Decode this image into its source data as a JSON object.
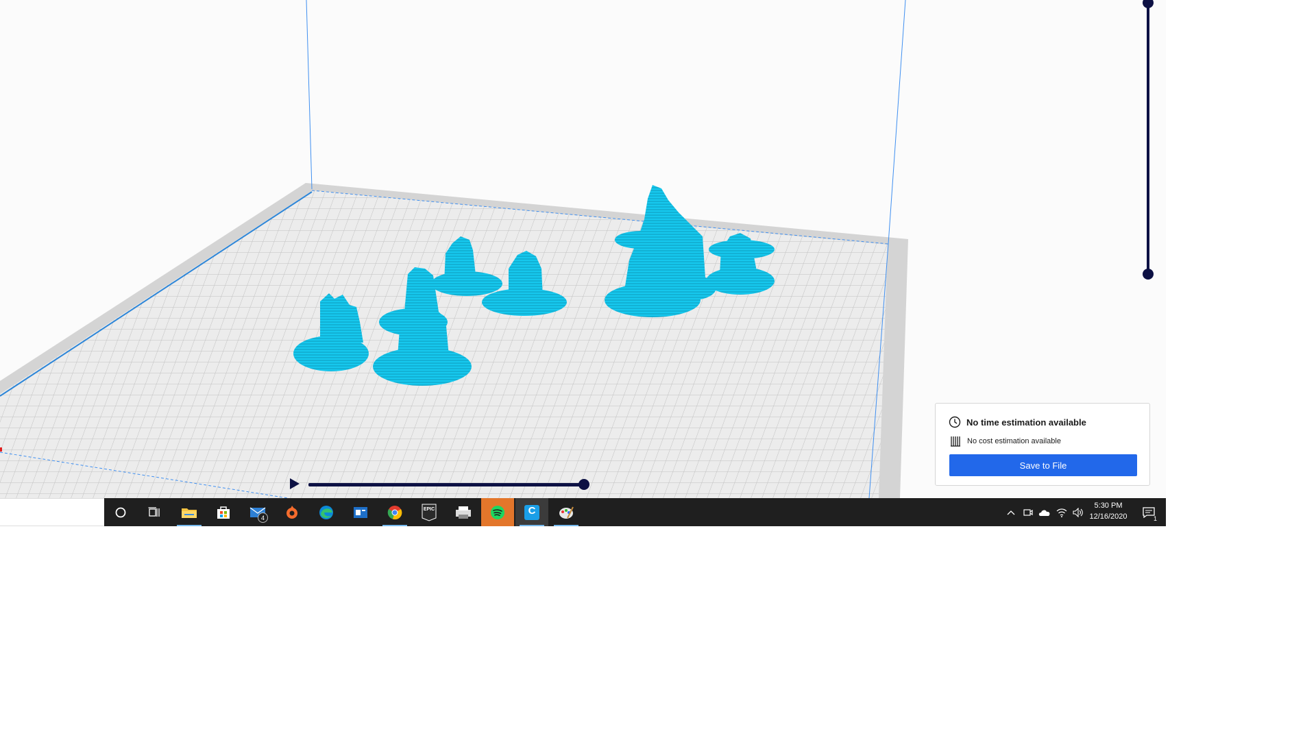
{
  "print_panel": {
    "time_estimate": "No time estimation available",
    "cost_estimate": "No cost estimation available",
    "save_label": "Save to File",
    "accent_color": "#2268ea"
  },
  "viewport": {
    "model_color": "#16c8ee",
    "buildplate_color": "#e6e6e6",
    "slider_color": "#0d1144"
  },
  "taskbar": {
    "apps": [
      {
        "icon": "cortana-circle-icon"
      },
      {
        "icon": "task-view-icon"
      },
      {
        "icon": "file-explorer-icon"
      },
      {
        "icon": "microsoft-store-icon"
      },
      {
        "icon": "mail-icon",
        "badge": "4"
      },
      {
        "icon": "origin-icon"
      },
      {
        "icon": "edge-icon"
      },
      {
        "icon": "news-icon"
      },
      {
        "icon": "chrome-icon"
      },
      {
        "icon": "epic-games-icon",
        "label": "EPIC"
      },
      {
        "icon": "printer-app-icon"
      },
      {
        "icon": "spotify-icon"
      },
      {
        "icon": "cura-icon",
        "label": "C"
      },
      {
        "icon": "paint-icon"
      }
    ],
    "tray_icons": [
      "chevron-up-icon",
      "meet-now-icon",
      "onedrive-icon",
      "wifi-icon",
      "volume-icon"
    ],
    "clock_time": "5:30 PM",
    "clock_date": "12/16/2020",
    "notifications_count": "1"
  }
}
